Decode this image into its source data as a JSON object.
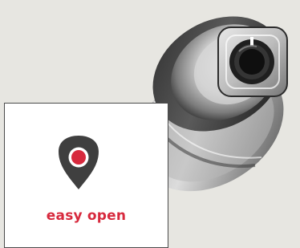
{
  "colors": {
    "background": "#e7e6e1",
    "shield": "#3f3f3f",
    "accent_red": "#d7293d",
    "card": "#ffffff"
  },
  "icons": {
    "brand_badge": "shield-target-icon",
    "product": "round-tool-device-icon"
  },
  "badge": {
    "text": "easy open"
  }
}
